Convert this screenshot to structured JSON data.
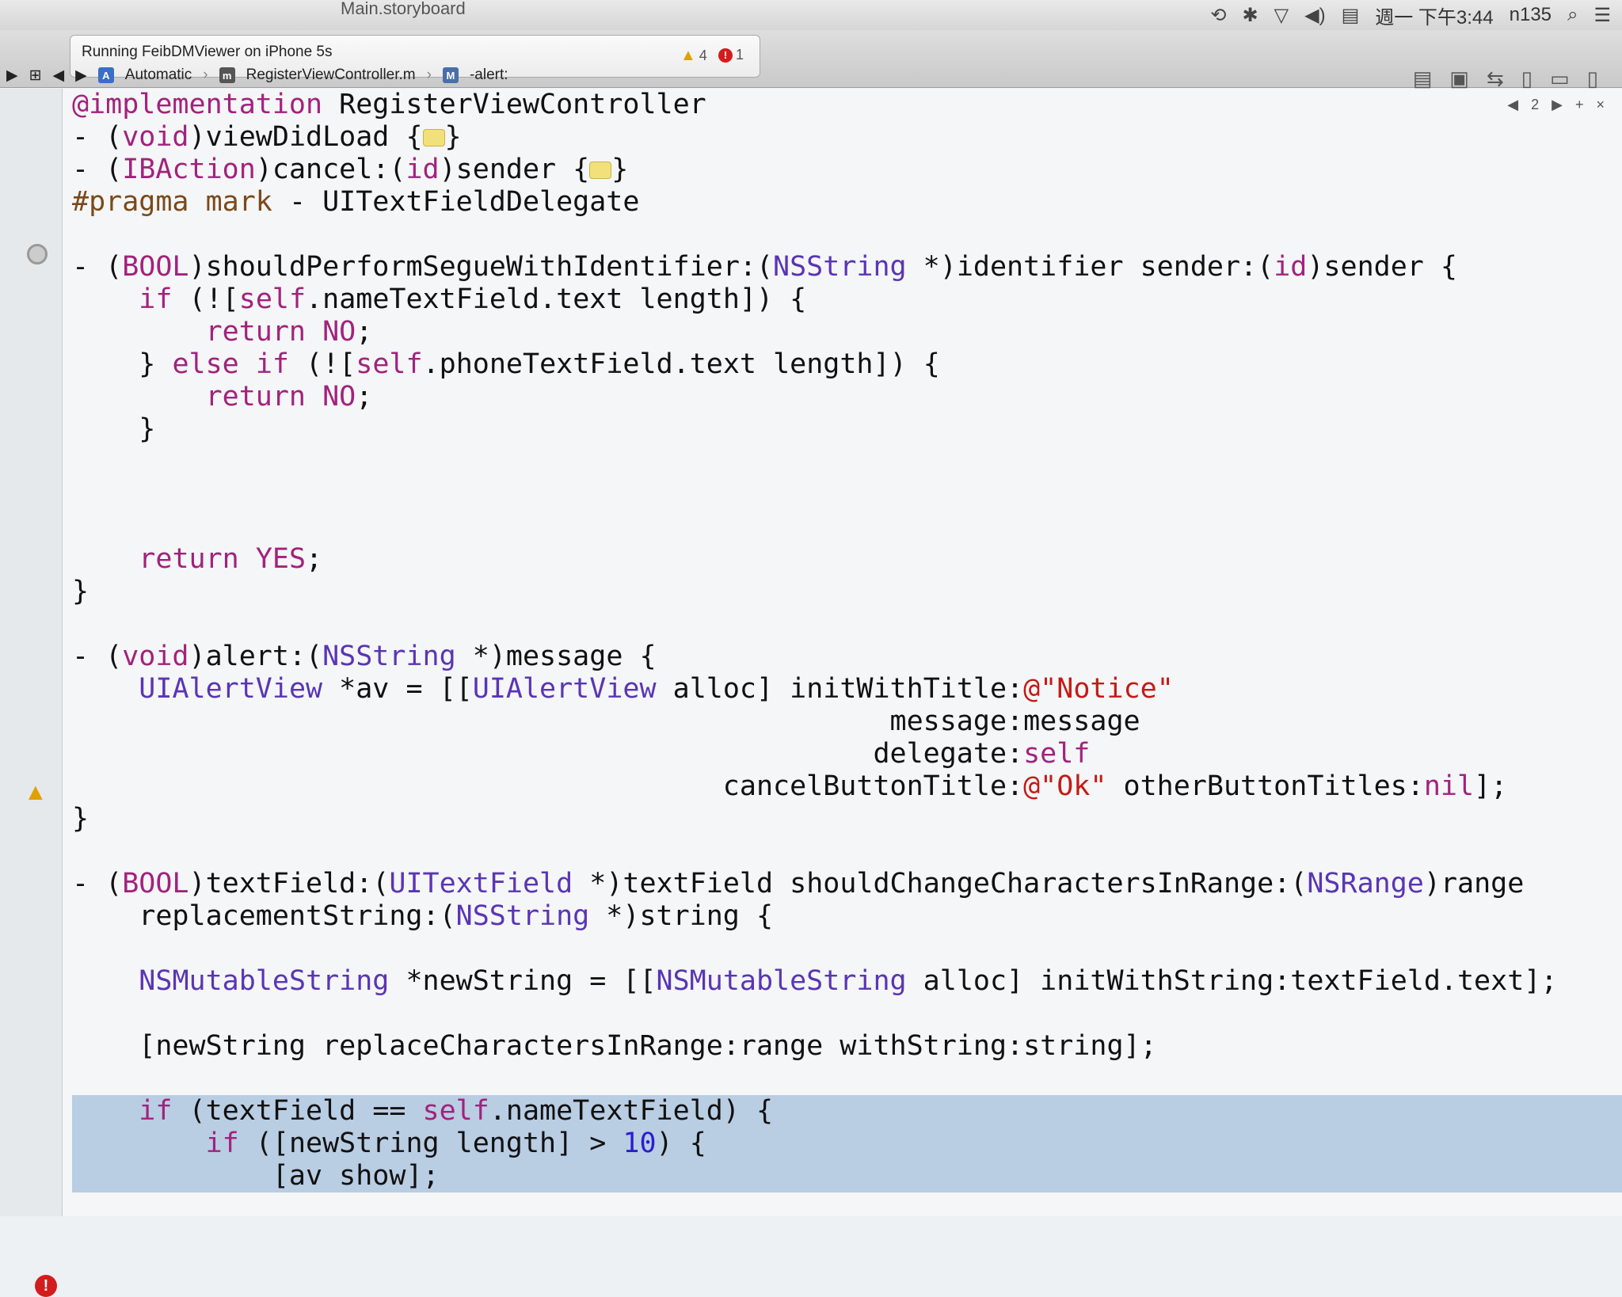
{
  "menubar": {
    "storyboard_tab": "Main.storyboard",
    "clock": "週一 下午3:44",
    "user": "n135"
  },
  "toolbar": {
    "activity": "Running FeibDMViewer on iPhone 5s",
    "warnings": "4",
    "errors": "1"
  },
  "jumpbar": {
    "scheme": "Automatic",
    "file": "RegisterViewController.m",
    "symbol": "-alert:"
  },
  "editor": {
    "counterpart": "2"
  },
  "code_lines": [
    "@implementation RegisterViewController",
    "- (void)viewDidLoad {…}",
    "- (IBAction)cancel:(id)sender {…}",
    "#pragma mark - UITextFieldDelegate",
    "",
    "- (BOOL)shouldPerformSegueWithIdentifier:(NSString *)identifier sender:(id)sender {",
    "    if (![self.nameTextField.text length]) {",
    "        return NO;",
    "    } else if (![self.phoneTextField.text length]) {",
    "        return NO;",
    "    }",
    "",
    "",
    "",
    "    return YES;",
    "}",
    "",
    "- (void)alert:(NSString *)message {",
    "    UIAlertView *av = [[UIAlertView alloc] initWithTitle:@\"Notice\"",
    "                                                 message:message",
    "                                                delegate:self",
    "                                       cancelButtonTitle:@\"Ok\" otherButtonTitles:nil];",
    "}",
    "",
    "- (BOOL)textField:(UITextField *)textField shouldChangeCharactersInRange:(NSRange)range",
    "    replacementString:(NSString *)string {",
    "",
    "    NSMutableString *newString = [[NSMutableString alloc] initWithString:textField.text];",
    "",
    "    [newString replaceCharactersInRange:range withString:string];",
    "",
    "    if (textField == self.nameTextField) {",
    "        if ([newString length] > 10) {",
    "            [av show];"
  ]
}
